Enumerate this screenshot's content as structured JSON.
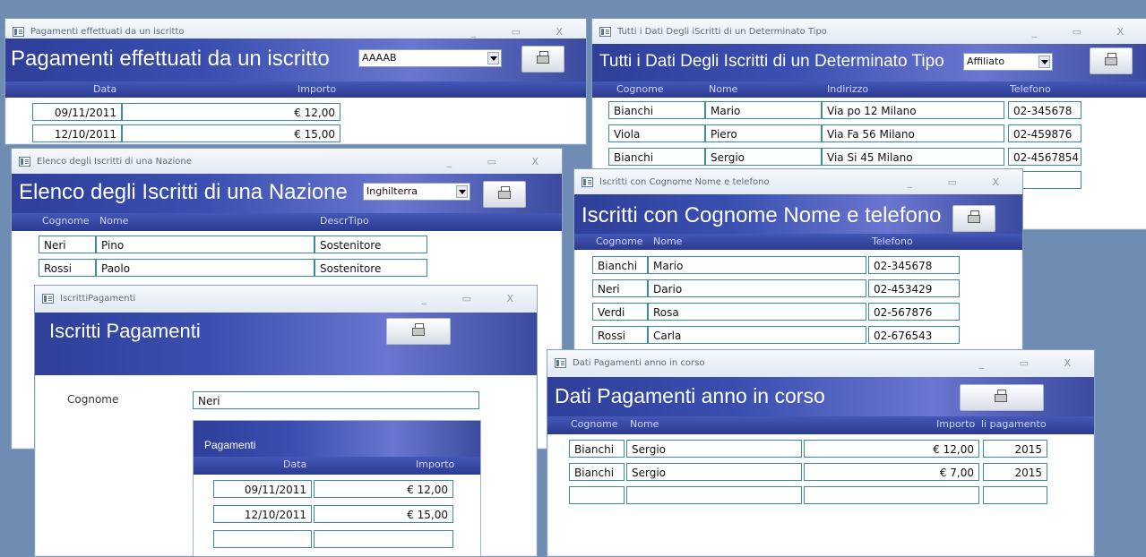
{
  "win_payments": {
    "title": "Pagamenti effettuati da un iscritto",
    "header": "Pagamenti effettuati da un iscritto",
    "combo_value": "AAAAB",
    "col_date": "Data",
    "col_amount": "Importo",
    "rows": [
      {
        "date": "09/11/2011",
        "amount": "€ 12,00"
      },
      {
        "date": "12/10/2011",
        "amount": "€ 15,00"
      }
    ]
  },
  "win_alldata": {
    "title": "Tutti i Dati Degli iScritti di un Determinato Tipo",
    "header": "Tutti i Dati Degli Iscritti di un Determinato Tipo",
    "combo_value": "Affiliato",
    "cols": [
      "Cognome",
      "Nome",
      "Indirizzo",
      "Telefono"
    ],
    "rows": [
      {
        "cognome": "Bianchi",
        "nome": "Mario",
        "indirizzo": "Via po 12 Milano",
        "telefono": "02-345678"
      },
      {
        "cognome": "Viola",
        "nome": "Piero",
        "indirizzo": "Via Fa 56 Milano",
        "telefono": "02-459876"
      },
      {
        "cognome": "Bianchi",
        "nome": "Sergio",
        "indirizzo": "Via Si 45 Milano",
        "telefono": "02-4567854"
      }
    ]
  },
  "win_nation": {
    "title": "Elenco degli Iscritti di una Nazione",
    "header": "Elenco degli Iscritti di una Nazione",
    "combo_value": "Inghilterra",
    "cols": [
      "Cognome",
      "Nome",
      "DescrTipo"
    ],
    "rows": [
      {
        "cognome": "Neri",
        "nome": "Pino",
        "tipo": "Sostenitore"
      },
      {
        "cognome": "Rossi",
        "nome": "Paolo",
        "tipo": "Sostenitore"
      }
    ]
  },
  "win_phone": {
    "title": "Iscritti con Cognome Nome e telefono",
    "header": "Iscritti con Cognome Nome e telefono",
    "cols": [
      "Cognome",
      "Nome",
      "Telefono"
    ],
    "rows": [
      {
        "cognome": "Bianchi",
        "nome": "Mario",
        "telefono": "02-345678"
      },
      {
        "cognome": "Neri",
        "nome": "Dario",
        "telefono": "02-453429"
      },
      {
        "cognome": "Verdi",
        "nome": "Rosa",
        "telefono": "02-567876"
      },
      {
        "cognome": "Rossi",
        "nome": "Carla",
        "telefono": "02-676543"
      }
    ]
  },
  "win_iscritti": {
    "title": "IscrittiPagamenti",
    "header": "Iscritti Pagamenti",
    "label_cognome": "Cognome",
    "cognome_value": "Neri",
    "sub_title": "Pagamenti",
    "col_date": "Data",
    "col_amount": "Importo",
    "rows": [
      {
        "date": "09/11/2011",
        "amount": "€ 12,00"
      },
      {
        "date": "12/10/2011",
        "amount": "€ 15,00"
      }
    ]
  },
  "win_year": {
    "title": "Dati Pagamenti anno in corso",
    "header": "Dati Pagamenti anno in corso",
    "cols": [
      "Cognome",
      "Nome",
      "Importo",
      "li pagamento"
    ],
    "rows": [
      {
        "cognome": "Bianchi",
        "nome": "Sergio",
        "importo": "€ 12,00",
        "anno": "2015"
      },
      {
        "cognome": "Bianchi",
        "nome": "Sergio",
        "importo": "€ 7,00",
        "anno": "2015"
      }
    ]
  },
  "controls": {
    "minimize": "_",
    "maximize": "▭",
    "close": "X"
  }
}
